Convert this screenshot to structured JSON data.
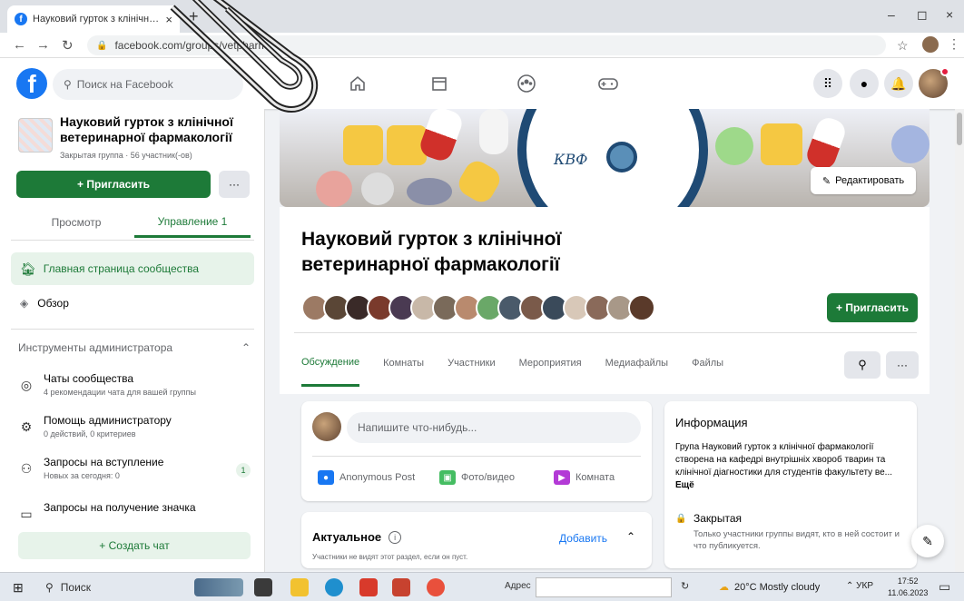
{
  "browser": {
    "tab_title": "Науковий гурток з клінічної ве",
    "tab_close": "×",
    "new_tab": "+",
    "url": "facebook.com/groups/vetpharm",
    "window_min": "–",
    "window_max": "◻",
    "window_close": "×"
  },
  "fb": {
    "logo": "f",
    "search_placeholder": "Поиск на Facebook",
    "nav_icons": [
      "home-icon",
      "marketplace-icon",
      "groups-icon",
      "gaming-icon"
    ],
    "accent": "#1d7a38",
    "brand": "#1877f2"
  },
  "sidebar": {
    "group_name": "Науковий гурток з клінічної ветеринарної фармакології",
    "group_meta": "Закрытая группа · 56 участник(-ов)",
    "invite": "+ Пригласить",
    "more": "···",
    "tab_view": "Просмотр",
    "tab_manage": "Управление 1",
    "home": "Главная страница сообщества",
    "overview": "Обзор",
    "admin_tools": "Инструменты администратора",
    "items": [
      {
        "title": "Чаты сообщества",
        "sub": "4 рекомендации чата для вашей группы"
      },
      {
        "title": "Помощь администратору",
        "sub": "0 действий, 0 критериев"
      },
      {
        "title": "Запросы на вступление",
        "sub": "Новых за сегодня: 0",
        "badge": "1"
      },
      {
        "title": "Запросы на получение значка",
        "sub": ""
      }
    ],
    "create_chat": "+ Создать чат"
  },
  "cover": {
    "logo_text": "КВФ",
    "edit": "Редактировать"
  },
  "group": {
    "title": "Науковий гурток з клінічної ветеринарної фармакології",
    "invite": "+ Пригласить",
    "tabs": [
      "Обсуждение",
      "Комнаты",
      "Участники",
      "Мероприятия",
      "Медиафайлы",
      "Файлы"
    ],
    "more": "···"
  },
  "composer": {
    "placeholder": "Напишите что-нибудь...",
    "actions": [
      "Anonymous Post",
      "Фото/видео",
      "Комната"
    ]
  },
  "featured": {
    "title": "Актуальное",
    "add": "Добавить",
    "note": "Участники не видят этот раздел, если он пуст."
  },
  "info": {
    "title": "Информация",
    "text": "Група Науковий гурток з клінічної фармакології створена на кафедрі внутрішніх хвороб тварин та клінічної діагностики для студентів факультету ве...",
    "more": "Ещё",
    "closed_title": "Закрытая",
    "closed_text": "Только участники группы видят, кто в ней состоит и что публикуется."
  },
  "taskbar": {
    "search": "Поиск",
    "address_label": "Адрес",
    "weather": "20°C Mostly cloudy",
    "lang": "УКР",
    "time": "17:52",
    "date": "11.06.2023"
  }
}
